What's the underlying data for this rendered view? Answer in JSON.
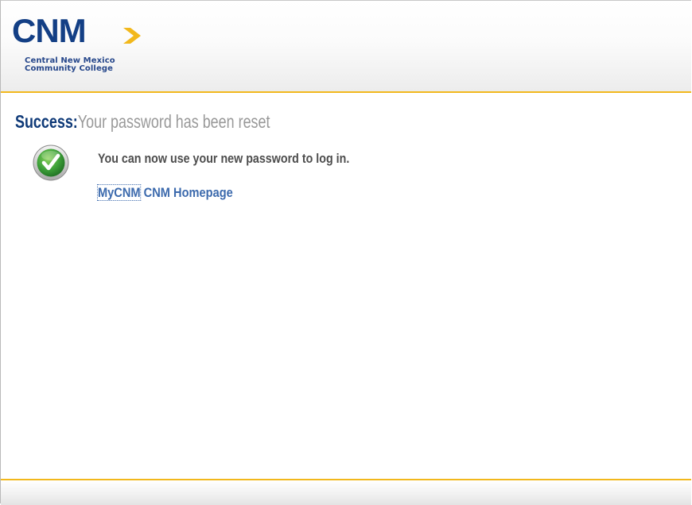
{
  "header": {
    "logo_text": "CNM",
    "logo_subtitle_line1": "Central New Mexico",
    "logo_subtitle_line2": "Community College"
  },
  "status": {
    "label": "Success:",
    "title": "Your password has been reset",
    "icon": "checkmark-circle-icon",
    "message": "You can now use your new password to log in."
  },
  "links": {
    "home_focus_part": "MyCNM",
    "home_rest": " CNM Homepage"
  },
  "colors": {
    "accent": "#f2b81c",
    "brand_navy": "#0f3a78",
    "link": "#3c6aad",
    "success_green": "#3a9b2e"
  }
}
